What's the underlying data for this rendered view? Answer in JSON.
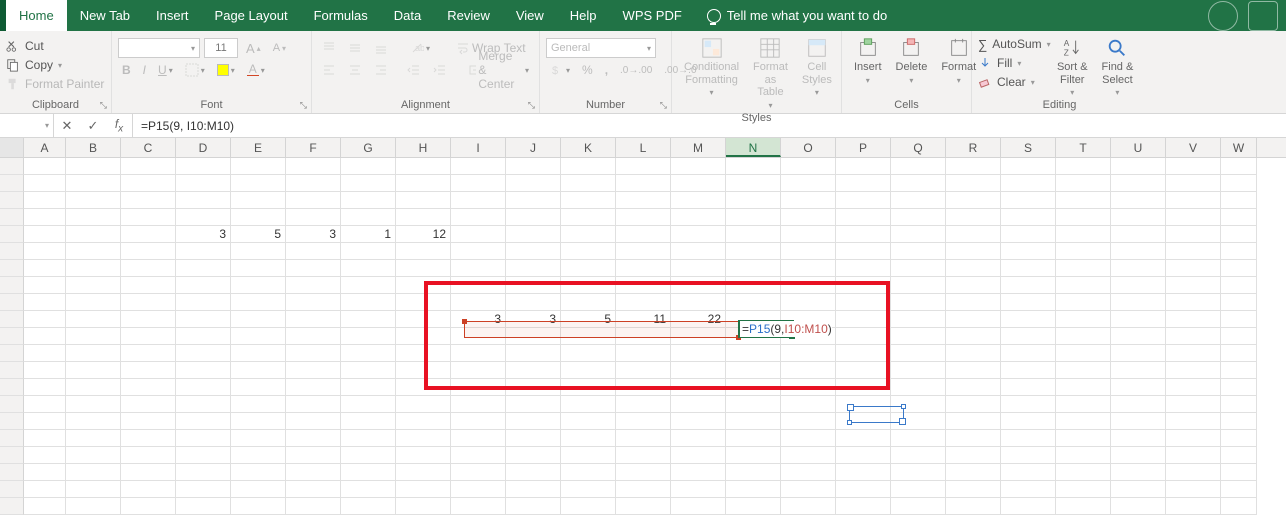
{
  "tabs": {
    "home": "Home",
    "newtab": "New Tab",
    "insert": "Insert",
    "pagelayout": "Page Layout",
    "formulas": "Formulas",
    "data": "Data",
    "review": "Review",
    "view": "View",
    "help": "Help",
    "wpspdf": "WPS PDF",
    "tell": "Tell me what you want to do"
  },
  "clipboard": {
    "cut": "Cut",
    "copy": "Copy",
    "painter": "Format Painter",
    "title": "Clipboard"
  },
  "font": {
    "size": "11",
    "title": "Font"
  },
  "alignment": {
    "wrap": "Wrap Text",
    "merge": "Merge & Center",
    "title": "Alignment"
  },
  "number": {
    "format": "General",
    "title": "Number"
  },
  "styles": {
    "cond": "Conditional Formatting",
    "fmtas": "Format as Table",
    "cell": "Cell Styles",
    "title": "Styles"
  },
  "cellsg": {
    "insert": "Insert",
    "delete": "Delete",
    "format": "Format",
    "title": "Cells"
  },
  "editing": {
    "autosum": "AutoSum",
    "fill": "Fill",
    "clear": "Clear",
    "sort": "Sort & Filter",
    "find": "Find & Select",
    "title": "Editing"
  },
  "namebox": "",
  "formula": "=P15(9, I10:M10)",
  "formula_tokens": {
    "eq": "=",
    "fn": "P15",
    "open": "(",
    "arg1": "9, ",
    "rng": "I10:M10",
    "close": ")"
  },
  "columns": [
    "A",
    "B",
    "C",
    "D",
    "E",
    "F",
    "G",
    "H",
    "I",
    "J",
    "K",
    "L",
    "M",
    "N",
    "O",
    "P",
    "Q",
    "R",
    "S",
    "T",
    "U",
    "V",
    "W"
  ],
  "row5": {
    "D": "3",
    "E": "5",
    "F": "3",
    "G": "1",
    "H": "12"
  },
  "row10": {
    "I": "3",
    "J": "3",
    "K": "5",
    "L": "11",
    "M": "22"
  }
}
